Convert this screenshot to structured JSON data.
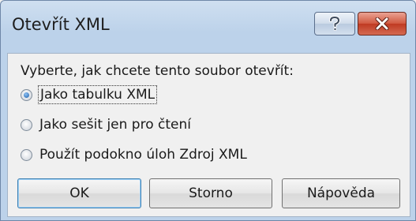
{
  "dialog": {
    "title": "Otevřít XML",
    "prompt": "Vyberte, jak chcete tento soubor otevřít:",
    "options": [
      {
        "label": "Jako tabulku XML",
        "checked": true
      },
      {
        "label": "Jako sešit jen pro čtení",
        "checked": false
      },
      {
        "label": "Použít podokno úloh Zdroj XML",
        "checked": false
      }
    ],
    "buttons": {
      "ok": "OK",
      "cancel": "Storno",
      "help": "Nápověda"
    }
  },
  "titlebar": {
    "help_icon": "question-icon",
    "close_icon": "close-icon"
  }
}
